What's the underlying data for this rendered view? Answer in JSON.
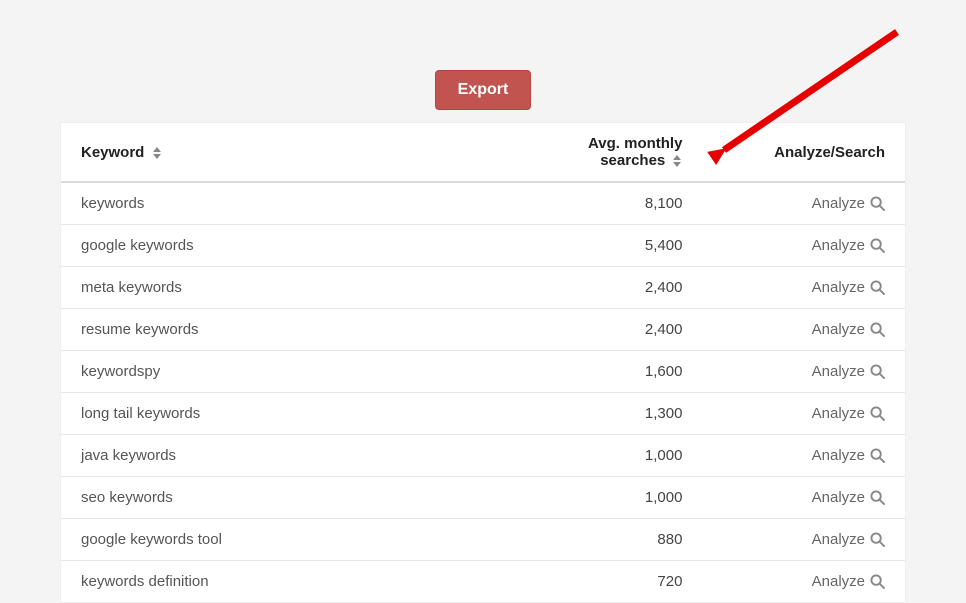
{
  "buttons": {
    "export": "Export"
  },
  "table": {
    "headers": {
      "keyword": "Keyword",
      "searches": "Avg. monthly searches",
      "analyze": "Analyze/Search"
    },
    "analyze_label": "Analyze",
    "rows": [
      {
        "keyword": "keywords",
        "searches": "8,100"
      },
      {
        "keyword": "google keywords",
        "searches": "5,400"
      },
      {
        "keyword": "meta keywords",
        "searches": "2,400"
      },
      {
        "keyword": "resume keywords",
        "searches": "2,400"
      },
      {
        "keyword": "keywordspy",
        "searches": "1,600"
      },
      {
        "keyword": "long tail keywords",
        "searches": "1,300"
      },
      {
        "keyword": "java keywords",
        "searches": "1,000"
      },
      {
        "keyword": "seo keywords",
        "searches": "1,000"
      },
      {
        "keyword": "google keywords tool",
        "searches": "880"
      },
      {
        "keyword": "keywords definition",
        "searches": "720"
      }
    ]
  }
}
